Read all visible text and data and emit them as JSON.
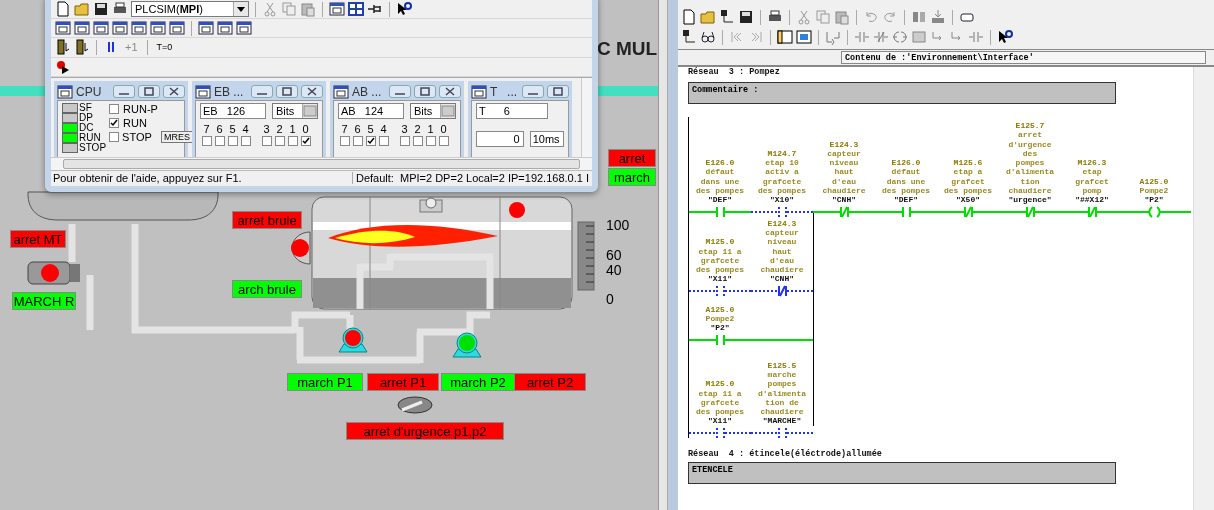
{
  "plcsim": {
    "target": "PLCSIM(**MPI**)",
    "step_buttons": [
      "+1",
      "T=0"
    ],
    "cpu": {
      "title": "CPU",
      "leds": [
        {
          "label": "SF",
          "on": false
        },
        {
          "label": "DP",
          "on": false
        },
        {
          "label": "DC",
          "on": true
        },
        {
          "label": "RUN",
          "on": true
        },
        {
          "label": "STOP",
          "on": false
        }
      ],
      "modes": [
        {
          "label": "RUN-P",
          "checked": false
        },
        {
          "label": "RUN",
          "checked": true
        },
        {
          "label": "STOP",
          "checked": false
        }
      ],
      "reset_button": "MRES"
    },
    "inputs": {
      "title": "EB ...",
      "address": "EB   126",
      "format": "Bits",
      "bits": [
        {
          "label": "7",
          "checked": false
        },
        {
          "label": "6",
          "checked": false
        },
        {
          "label": "5",
          "checked": false
        },
        {
          "label": "4",
          "checked": false
        },
        {
          "label": "3",
          "checked": false
        },
        {
          "label": "2",
          "checked": false
        },
        {
          "label": "1",
          "checked": false
        },
        {
          "label": "0",
          "checked": true
        }
      ]
    },
    "outputs": {
      "title": "AB ...",
      "address": "AB   124",
      "format": "Bits",
      "bits": [
        {
          "label": "7",
          "checked": false
        },
        {
          "label": "6",
          "checked": false
        },
        {
          "label": "5",
          "checked": true
        },
        {
          "label": "4",
          "checked": false
        },
        {
          "label": "3",
          "checked": false
        },
        {
          "label": "2",
          "checked": false
        },
        {
          "label": "1",
          "checked": false
        },
        {
          "label": "0",
          "checked": false
        }
      ]
    },
    "timer": {
      "title": "T   ...",
      "address": "T      6",
      "value": "0",
      "base": "10ms"
    },
    "status_bar": {
      "help": "Pour obtenir de l'aide, appuyez sur F1.",
      "connection": "Default:  MPI=2 DP=2 Local=2 IP=192.168.0.1 I"
    }
  },
  "hmi": {
    "heading": "C MUL",
    "buttons": [
      {
        "label": "arret",
        "color": "#ff0000"
      },
      {
        "label": "march",
        "color": "#00ff00"
      },
      {
        "label": "arret brule",
        "color": "#ff0000"
      },
      {
        "label": "arret MT",
        "color": "#ff0000"
      },
      {
        "label": "arch brule",
        "color": "#00ff00"
      },
      {
        "label": "MARCH R",
        "color": "#00ff00"
      },
      {
        "label": "march P1",
        "color": "#00ff00"
      },
      {
        "label": "arret P1",
        "color": "#ff0000"
      },
      {
        "label": "march P2",
        "color": "#00ff00"
      },
      {
        "label": "arret P2",
        "color": "#ff0000"
      },
      {
        "label": "arret d'urgence p1,p2",
        "color": "#ff0000"
      }
    ],
    "gauge_ticks": [
      "100",
      "60",
      "40",
      "0"
    ],
    "pumps": [
      {
        "running": false
      },
      {
        "running": true
      }
    ],
    "burner_running": false,
    "motor_running": false,
    "valve_lamp_on": false
  },
  "editor": {
    "path": "Contenu de :'Environnement\\Interface'",
    "networks": [
      {
        "title": "Réseau  3 : Pompez",
        "comment": "Commentaire :",
        "rungs": [
          [
            {
              "kind": "no",
              "address": "E126.0",
              "comment_lines": [
                "défaut",
                "dans une",
                "des pompes"
              ],
              "symbol": "\"DEF\"",
              "powered": true
            },
            {
              "kind": "no",
              "address": "M124.7",
              "comment_lines": [
                "etap 10",
                "activ a",
                "grafcete",
                "des pompes"
              ],
              "symbol": "\"X10\"",
              "powered": false
            },
            {
              "kind": "nc",
              "address": "E124.3",
              "comment_lines": [
                "capteur",
                "niveau",
                "haut",
                "d'eau",
                "chaudiere"
              ],
              "symbol": "\"CNH\"",
              "powered": true
            },
            {
              "kind": "no",
              "address": "E126.0",
              "comment_lines": [
                "défaut",
                "dans une",
                "des pompes"
              ],
              "symbol": "\"DEF\"",
              "powered": true
            },
            {
              "kind": "nc",
              "address": "M125.6",
              "comment_lines": [
                "etap a",
                "grafcet",
                "des pompes"
              ],
              "symbol": "\"X50\"",
              "powered": true
            },
            {
              "kind": "nc",
              "address": "E125.7",
              "comment_lines": [
                "arret",
                "d'urgence",
                "des",
                "pompes",
                "d'alimenta",
                "tion",
                "chaudiere"
              ],
              "symbol": "\"urgence\"",
              "powered": true
            },
            {
              "kind": "nc",
              "address": "M126.3",
              "comment_lines": [
                "etap",
                "grafcet",
                "pomp"
              ],
              "symbol": "\"##X12\"",
              "powered": true
            },
            {
              "kind": "coil",
              "address": "A125.0",
              "comment_lines": [
                "Pompe2"
              ],
              "symbol": "\"P2\"",
              "powered": true
            }
          ],
          [
            {
              "kind": "no",
              "address": "M125.0",
              "comment_lines": [
                "etap 11 a",
                "grafcete",
                "des pompes"
              ],
              "symbol": "\"X11\"",
              "powered": false
            },
            {
              "kind": "nc",
              "address": "E124.3",
              "comment_lines": [
                "capteur",
                "niveau",
                "haut",
                "d'eau",
                "chaudiere"
              ],
              "symbol": "\"CNH\"",
              "powered": false
            }
          ],
          [
            {
              "kind": "no",
              "address": "A125.0",
              "comment_lines": [
                "Pompe2"
              ],
              "symbol": "\"P2\"",
              "powered": true
            }
          ],
          [
            {
              "kind": "no",
              "address": "M125.0",
              "comment_lines": [
                "etap 11 a",
                "grafcete",
                "des pompes"
              ],
              "symbol": "\"X11\"",
              "powered": false
            },
            {
              "kind": "no",
              "address": "E125.5",
              "comment_lines": [
                "marche",
                "pompes",
                "d'alimenta",
                "tion de",
                "chaudiere"
              ],
              "symbol": "\"MARCHE\"",
              "powered": false
            }
          ]
        ]
      },
      {
        "title": "Réseau  4 : étincele(éléctrode)allumée",
        "comment": "ETENCELE"
      }
    ]
  }
}
